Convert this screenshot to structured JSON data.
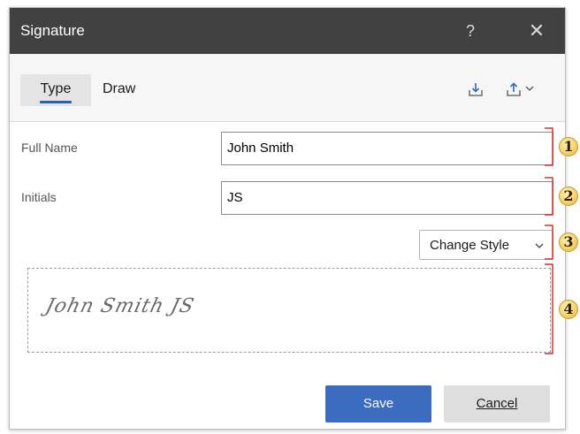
{
  "dialog": {
    "title": "Signature",
    "help_label": "?",
    "close_label": "✕"
  },
  "tabs": {
    "type_label": "Type",
    "draw_label": "Draw"
  },
  "toolbar": {
    "import_icon": "import-icon",
    "export_icon": "export-icon",
    "export_dropdown_icon": "chevron-down-icon"
  },
  "form": {
    "full_name_label": "Full Name",
    "full_name_value": "John Smith",
    "initials_label": "Initials",
    "initials_value": "JS",
    "change_style_label": "Change Style"
  },
  "preview": {
    "signature_text": "John Smith   JS"
  },
  "footer": {
    "save_label": "Save",
    "cancel_label": "Cancel"
  },
  "callouts": {
    "bracket_color": "#d9312b",
    "numbers": [
      "1",
      "2",
      "3",
      "4"
    ]
  },
  "colors": {
    "title_bar": "#414141",
    "accent": "#3b6cc0",
    "tab_underline": "#2b5fb3"
  }
}
